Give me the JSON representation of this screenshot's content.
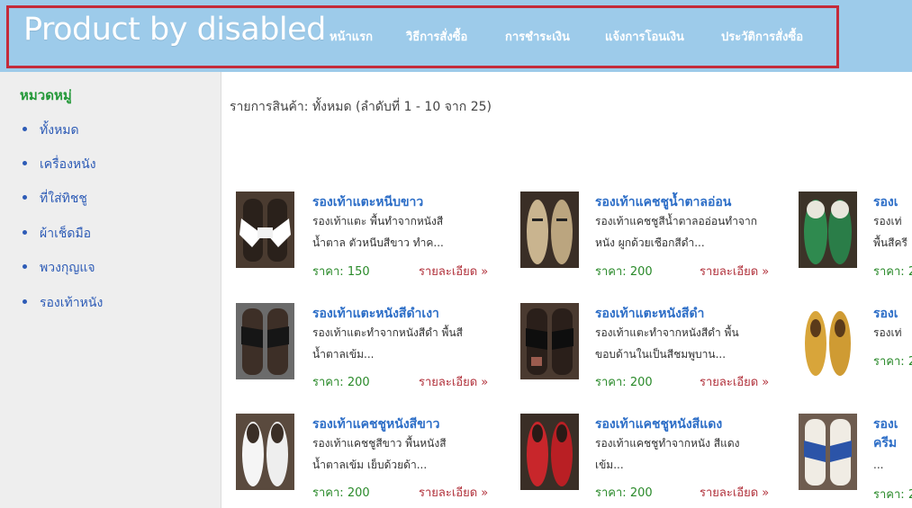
{
  "header": {
    "title": "Product by disabled",
    "nav": [
      "หน้าแรก",
      "วิธีการสั่งซื้อ",
      "การชำระเงิน",
      "แจ้งการโอนเงิน",
      "ประวัติการสั่งซื้อ"
    ]
  },
  "sidebar": {
    "title": "หมวดหมู่",
    "items": [
      "ทั้งหมด",
      "เครื่องหนัง",
      "ที่ใส่ทิชชู",
      "ผ้าเช็ดมือ",
      "พวงกุญแจ",
      "รองเท้าหนัง"
    ]
  },
  "summary": "รายการสินค้า: ทั้งหมด (ลำดับที่ 1 - 10 จาก 25)",
  "labels": {
    "price_prefix": "ราคา:",
    "details": "รายละเอียด »"
  },
  "products": [
    {
      "name": "รองเท้าแตะหนีบขาว",
      "desc1": "รองเท้าแตะ พื้นทำจากหนังสี",
      "desc2": "น้ำตาล ตัวหนีบสีขาว ทำค...",
      "price": "150"
    },
    {
      "name": "รองเท้าแคชชูน้ำตาลอ่อน",
      "desc1": "รองเท้าแคชชูสีน้ำตาลออ่อนทำจาก",
      "desc2": "หนัง ผูกด้วยเชือกสีดำ...",
      "price": "200"
    },
    {
      "name": "รองเ",
      "desc1": "รองเท่",
      "desc2": "พื้นสีครี",
      "price": "2"
    },
    {
      "name": "รองเท้าแตะหนังสีดำเงา",
      "desc1": "รองเท้าแตะทำจากหนังสีดำ พื้นสี",
      "desc2": "น้ำตาลเข้ม...",
      "price": "200"
    },
    {
      "name": "รองเท้าแตะหนังสีดำ",
      "desc1": "รองเท้าแตะทำจากหนังสีดำ พื้น",
      "desc2": "ขอบด้านในเป็นสีชมพูบาน...",
      "price": "200"
    },
    {
      "name": "รองเ",
      "desc1": "รองเท่",
      "desc2": "",
      "price": "2"
    },
    {
      "name": "รองเท้าแคชชูหนังสีขาว",
      "desc1": "รองเท้าแคชชูสีขาว พื้นหนังสี",
      "desc2": "น้ำตาลเข้ม เย็บด้วยด้า...",
      "price": "200"
    },
    {
      "name": "รองเท้าแคชชูหนังสีแดง",
      "desc1": "รองเท้าแคชชูทำจากหนัง สีแดง",
      "desc2": "เข้ม...",
      "price": "200"
    },
    {
      "name": "รองเ",
      "desc1": "ครีม",
      "desc2": "...",
      "price": "2"
    }
  ],
  "colors": {
    "header_bg": "#9dcbea",
    "frame": "#c42b3a",
    "sidebar_bg": "#eeeeee",
    "category_title": "#25993a",
    "link": "#2d5bb6",
    "price": "#2a8a2a",
    "detail_link": "#b1313b"
  }
}
